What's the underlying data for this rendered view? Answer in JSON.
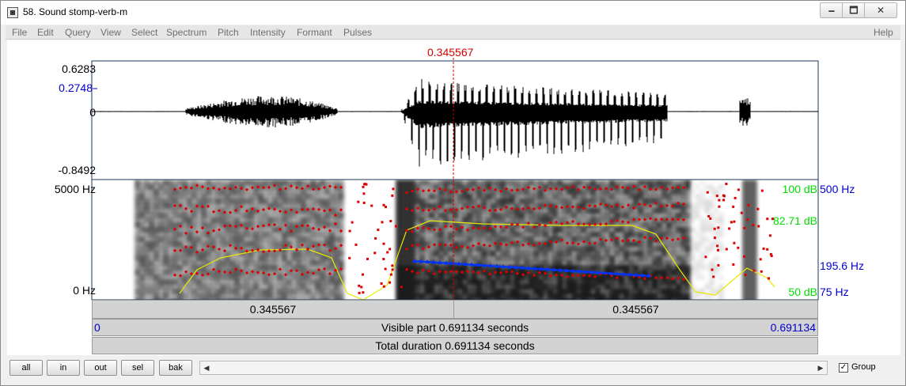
{
  "window": {
    "title": "58. Sound stomp-verb-m",
    "min_glyph": "🗕",
    "max_glyph": "🗖",
    "close_glyph": "✕"
  },
  "menu": [
    "File",
    "Edit",
    "Query",
    "View",
    "Select",
    "Spectrum",
    "Pitch",
    "Intensity",
    "Formant",
    "Pulses",
    "Help"
  ],
  "cursor": {
    "time_label": "0.345567"
  },
  "waveform": {
    "y_max": "0.6283",
    "y_cursor": "0.2748",
    "y_zero": "0",
    "y_min": "-0.8492"
  },
  "spectrogram": {
    "freq_top": "5000 Hz",
    "freq_bottom": "0 Hz",
    "intensity_top": "100 dB",
    "intensity_value": "82.71 dB",
    "intensity_bottom": "50 dB",
    "pitch_top": "500 Hz",
    "pitch_value": "195.6 Hz",
    "pitch_bottom": "75 Hz"
  },
  "timebars": {
    "left_part": "0.345567",
    "right_part": "0.345567",
    "visible_start": "0",
    "visible_label": "Visible part 0.691134 seconds",
    "visible_end": "0.691134",
    "total_label": "Total duration 0.691134 seconds"
  },
  "toolbar": {
    "buttons": [
      "all",
      "in",
      "out",
      "sel",
      "bak"
    ],
    "group_label": "Group",
    "group_checked": true,
    "check_glyph": "✓",
    "scroll_left": "◀",
    "scroll_right": "▶"
  },
  "colors": {
    "cursor": "#d40000",
    "axis_blue": "#0000cc",
    "intensity_green": "#00dd00",
    "formant_red": "#e00000",
    "pitch_blue": "#0033ff",
    "intensity_curve": "#e8e800"
  }
}
